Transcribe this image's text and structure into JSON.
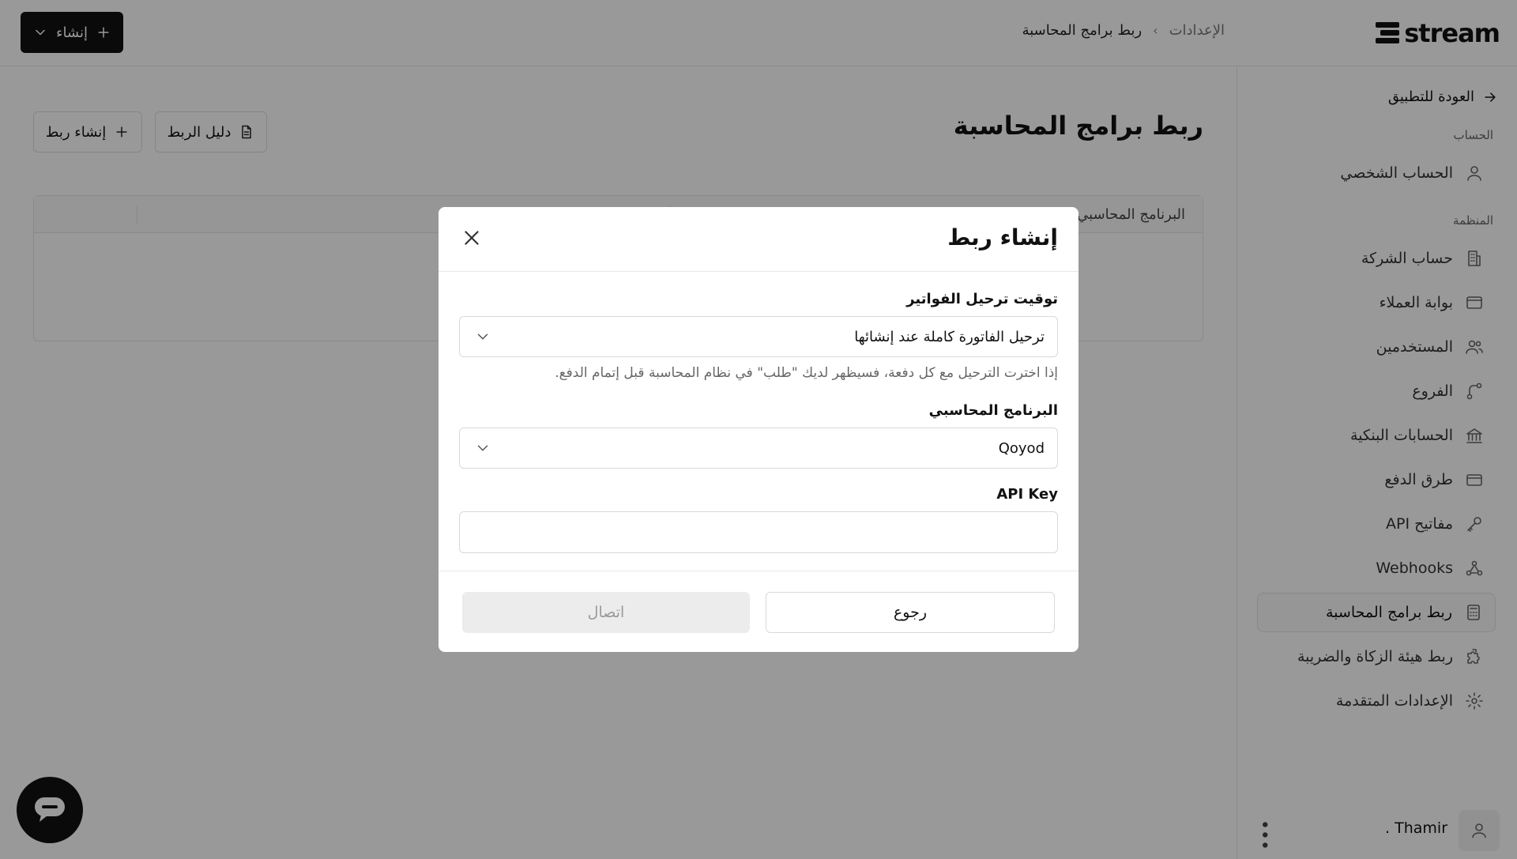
{
  "app": {
    "brand": "stream"
  },
  "header": {
    "breadcrumb": {
      "parent": "الإعدادات",
      "separator": "›",
      "current": "ربط برامج المحاسبة"
    },
    "create_button": {
      "label": "إنشاء",
      "plus_icon": "plus-icon",
      "dropdown_icon": "chevron-down-icon"
    }
  },
  "sidebar": {
    "back_label": "العودة للتطبيق",
    "sections": {
      "account": "الحساب",
      "organization": "المنظمة"
    },
    "items": [
      {
        "label": "الحساب الشخصي",
        "icon": "user-icon"
      },
      {
        "label": "حساب الشركة",
        "icon": "building-icon"
      },
      {
        "label": "بوابة العملاء",
        "icon": "window-icon"
      },
      {
        "label": "المستخدمين",
        "icon": "users-icon"
      },
      {
        "label": "الفروع",
        "icon": "branch-icon"
      },
      {
        "label": "الحسابات البنكية",
        "icon": "bank-icon"
      },
      {
        "label": "طرق الدفع",
        "icon": "credit-card-icon"
      },
      {
        "label": "مفاتيح API",
        "icon": "key-icon"
      },
      {
        "label": "Webhooks",
        "icon": "webhook-icon"
      },
      {
        "label": "ربط برامج المحاسبة",
        "icon": "calculator-icon",
        "active": true
      },
      {
        "label": "ربط هيئة الزكاة والضريبة",
        "icon": "puzzle-icon"
      },
      {
        "label": "الإعدادات المتقدمة",
        "icon": "gear-icon"
      }
    ],
    "user": {
      "name": "Thamir .",
      "avatar_icon": "user-icon",
      "menu_icon": "more-vertical-icon"
    }
  },
  "main": {
    "title": "ربط برامج المحاسبة",
    "guide_button": "دليل الربط",
    "new_link_button": "إنشاء ربط",
    "table": {
      "columns": [
        "البرنامج المحاسبي"
      ]
    }
  },
  "modal": {
    "title": "إنشاء ربط",
    "fields": {
      "posting_timing": {
        "label": "توقيت ترحيل الفواتير",
        "value": "ترحيل الفاتورة كاملة عند إنشائها",
        "help": "إذا اخترت الترحيل مع كل دفعة، فسيظهر لديك \"طلب\" في نظام المحاسبة قبل إتمام الدفع."
      },
      "accounting_software": {
        "label": "البرنامج المحاسبي",
        "value": "Qoyod"
      },
      "api_key": {
        "label": "API Key",
        "value": "",
        "placeholder": ""
      }
    },
    "buttons": {
      "back": "رجوع",
      "connect": "اتصال"
    }
  },
  "colors": {
    "primary": "#111111",
    "overlay": "rgba(0,0,0,0.40)",
    "disabled_bg": "#ececec",
    "disabled_text": "#9a9a9a"
  }
}
